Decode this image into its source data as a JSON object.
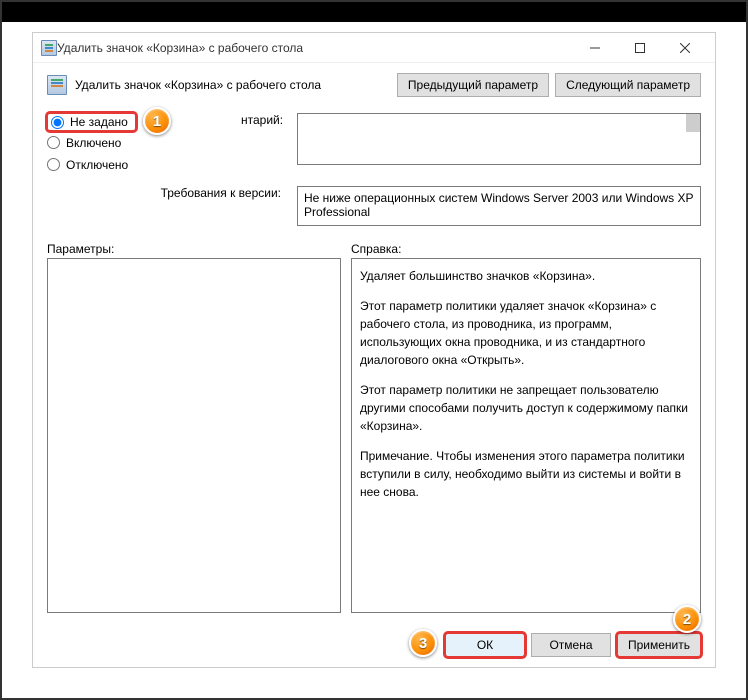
{
  "window": {
    "title": "Удалить значок «Корзина» с рабочего стола"
  },
  "header": {
    "title": "Удалить значок «Корзина» с рабочего стола",
    "prev": "Предыдущий параметр",
    "next": "Следующий параметр"
  },
  "state": {
    "not_configured": "Не заданo",
    "enabled": "Включено",
    "disabled": "Отключено",
    "selected": "not_configured"
  },
  "comment": {
    "label": "Комментарий:",
    "label_visible_fragment": "нтарий:",
    "value": ""
  },
  "requirements": {
    "label": "Требования к версии:",
    "text": "Не ниже операционных систем Windows Server 2003 или Windows XP Professional"
  },
  "sections": {
    "parameters": "Параметры:",
    "help": "Справка:"
  },
  "help_text": {
    "p1": "Удаляет большинство значков «Корзина».",
    "p2": "Этот параметр политики удаляет значок «Корзина» с рабочего стола, из проводника, из программ, использующих окна проводника, и из стандартного диалогового окна «Открыть».",
    "p3": "Этот параметр политики не запрещает пользователю другими способами получить доступ к содержимому папки «Корзина».",
    "p4": "Примечание. Чтобы изменения этого параметра политики вступили в силу, необходимо выйти из системы и войти в нее снова."
  },
  "footer": {
    "ok": "ОК",
    "cancel": "Отмена",
    "apply": "Применить"
  },
  "annotations": {
    "1": "1",
    "2": "2",
    "3": "3"
  }
}
